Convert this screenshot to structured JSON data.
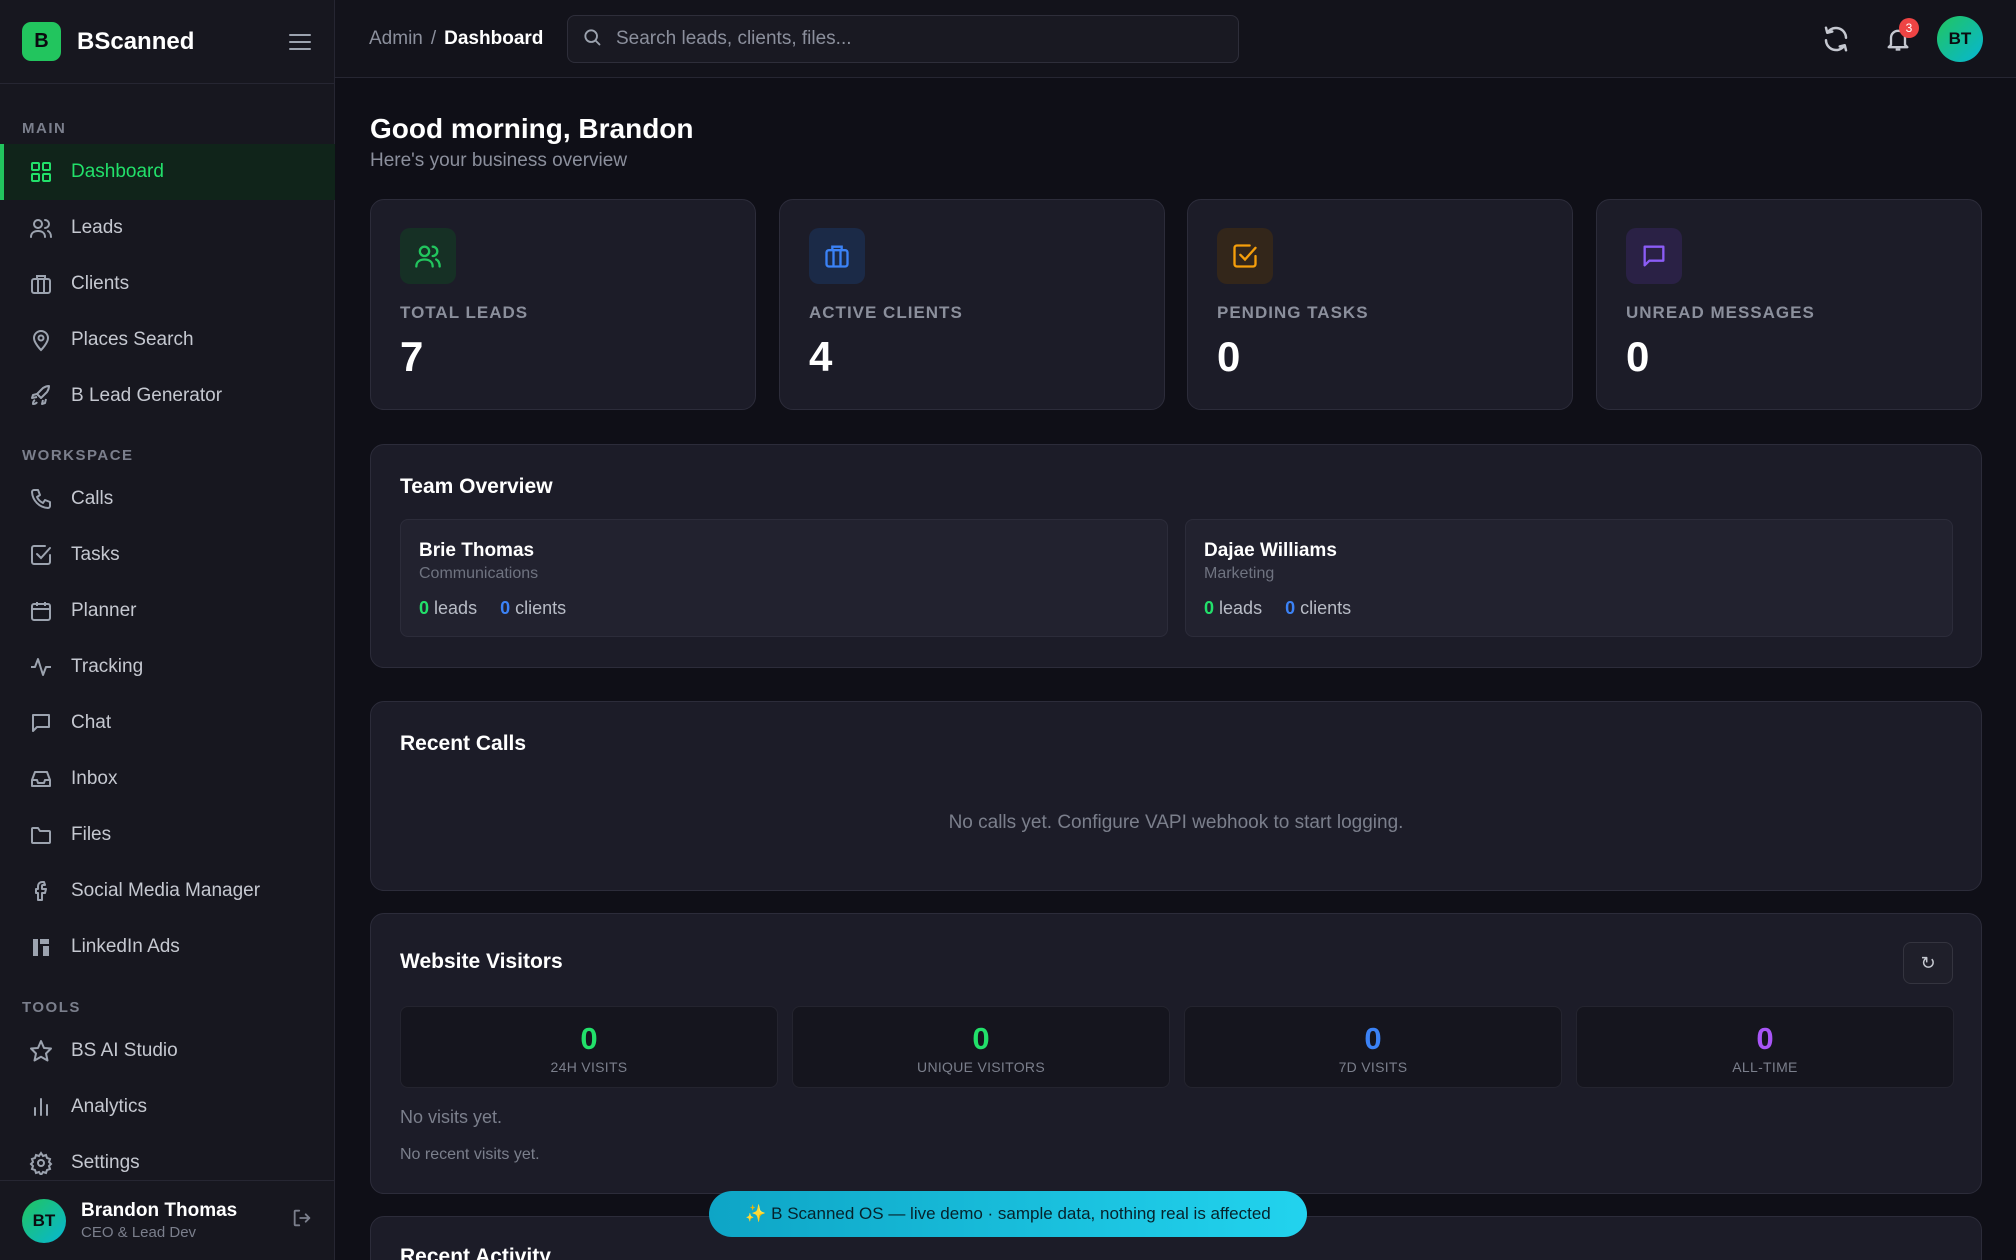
{
  "brand": {
    "logo_letter": "B",
    "name": "BScanned",
    "accent": "#22c55e"
  },
  "sidebar": {
    "sections": {
      "main": "MAIN",
      "workspace": "WORKSPACE",
      "tools": "TOOLS"
    },
    "items": [
      {
        "label": "Dashboard",
        "icon": "grid-icon"
      },
      {
        "label": "Leads",
        "icon": "users-icon"
      },
      {
        "label": "Clients",
        "icon": "briefcase-icon"
      },
      {
        "label": "Places Search",
        "icon": "map-pin-icon"
      },
      {
        "label": "B Lead Generator",
        "icon": "rocket-icon"
      },
      {
        "label": "Calls",
        "icon": "phone-icon"
      },
      {
        "label": "Tasks",
        "icon": "check-square-icon"
      },
      {
        "label": "Planner",
        "icon": "calendar-icon"
      },
      {
        "label": "Tracking",
        "icon": "activity-icon"
      },
      {
        "label": "Chat",
        "icon": "message-icon"
      },
      {
        "label": "Inbox",
        "icon": "inbox-icon"
      },
      {
        "label": "Files",
        "icon": "folder-icon"
      },
      {
        "label": "Social Media Manager",
        "icon": "facebook-icon"
      },
      {
        "label": "LinkedIn Ads",
        "icon": "linkedin-icon"
      },
      {
        "label": "BS AI Studio",
        "icon": "star-icon"
      },
      {
        "label": "Analytics",
        "icon": "bar-chart-icon"
      },
      {
        "label": "Settings",
        "icon": "gear-icon"
      }
    ],
    "user": {
      "initials": "BT",
      "name": "Brandon Thomas",
      "role": "CEO & Lead Dev"
    }
  },
  "topbar": {
    "breadcrumb": {
      "root": "Admin",
      "separator": "/",
      "current": "Dashboard"
    },
    "search_placeholder": "Search leads, clients, files...",
    "notification_count": "3",
    "avatar_initials": "BT"
  },
  "main": {
    "greeting": "Good morning, Brandon",
    "subtitle": "Here's your business overview",
    "stats": [
      {
        "label": "TOTAL LEADS",
        "value": "7",
        "color": "#22c55e"
      },
      {
        "label": "ACTIVE CLIENTS",
        "value": "4",
        "color": "#3b82f6"
      },
      {
        "label": "PENDING TASKS",
        "value": "0",
        "color": "#f59e0b"
      },
      {
        "label": "UNREAD MESSAGES",
        "value": "0",
        "color": "#8b5cf6"
      }
    ],
    "team": {
      "title": "Team Overview",
      "members": [
        {
          "name": "Brie Thomas",
          "dept": "Communications",
          "leads": "0",
          "leads_label": "leads",
          "clients": "0",
          "clients_label": "clients"
        },
        {
          "name": "Dajae Williams",
          "dept": "Marketing",
          "leads": "0",
          "leads_label": "leads",
          "clients": "0",
          "clients_label": "clients"
        }
      ]
    },
    "calls": {
      "title": "Recent Calls",
      "empty": "No calls yet. Configure VAPI webhook to start logging."
    },
    "visitors": {
      "title": "Website Visitors",
      "refresh_label": "↻",
      "tiles": [
        {
          "value": "0",
          "label": "24H VISITS",
          "color": "#22e06a"
        },
        {
          "value": "0",
          "label": "UNIQUE VISITORS",
          "color": "#22e06a"
        },
        {
          "value": "0",
          "label": "7D VISITS",
          "color": "#3b82f6"
        },
        {
          "value": "0",
          "label": "ALL-TIME",
          "color": "#a855f7"
        }
      ],
      "no_visits": "No visits yet.",
      "no_recent": "No recent visits yet."
    },
    "activity": {
      "title": "Recent Activity"
    }
  },
  "toast": {
    "text": "✨ B Scanned OS — live demo · sample data, nothing real is affected"
  }
}
